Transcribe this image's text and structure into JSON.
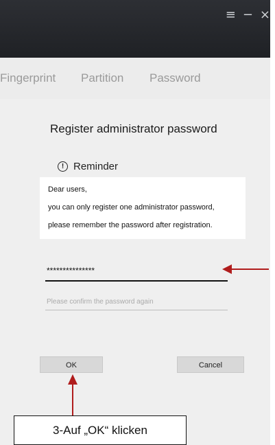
{
  "window": {
    "controls": {
      "menu": "≡",
      "minimize": "−",
      "close": "×"
    }
  },
  "tabs": [
    {
      "label": "Fingerprint"
    },
    {
      "label": "Partition"
    },
    {
      "label": "Password"
    }
  ],
  "dialog": {
    "heading": "Register administrator password",
    "reminder_title": "Reminder",
    "reminder_lines": [
      "Dear users,",
      "you can only register one administrator password,",
      "please remember the password after registration."
    ],
    "password_value": "***************",
    "confirm_placeholder": "Please confirm the password again",
    "ok_label": "OK",
    "cancel_label": "Cancel"
  },
  "annotation": {
    "callout_text": "3-Auf „OK“ klicken",
    "arrow_color": "#b01c1c"
  }
}
